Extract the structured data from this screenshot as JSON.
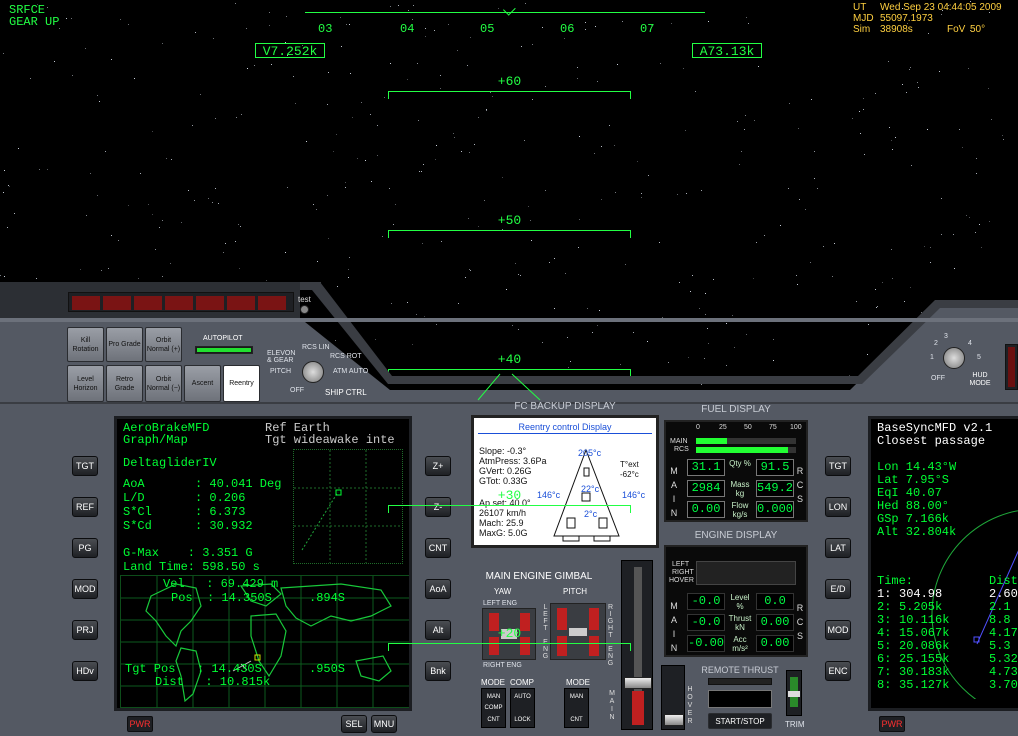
{
  "hud": {
    "mode_line1": "SRFCE",
    "mode_line2": "GEAR UP",
    "heading_ticks": [
      "03",
      "04",
      "05",
      "06",
      "07"
    ],
    "velocity": "V7.252k",
    "altitude": "A73.13k",
    "pitch_ladder": [
      "+60",
      "+50",
      "+40",
      "+30",
      "+20"
    ]
  },
  "sim_info": {
    "ut_label": "UT",
    "ut_value": "Wed Sep 23 04:44:05 2009",
    "mjd_label": "MJD",
    "mjd_value": "55097.1973",
    "sim_label": "Sim",
    "sim_value": "38908s",
    "fov_label": "FoV",
    "fov_value": "50°"
  },
  "warning_panel": {
    "lights": [
      "",
      "",
      "",
      "",
      "",
      "",
      ""
    ],
    "test_label": "test"
  },
  "nav_buttons": {
    "kill_rotation": "Kill Rotation",
    "pro_grade": "Pro Grade",
    "orbit_normal_plus": "Orbit Normal (+)",
    "level_horizon": "Level Horizon",
    "retro_grade": "Retro Grade",
    "orbit_normal_minus": "Orbit Normal (−)",
    "ascent": "Ascent",
    "reentry": "Reentry",
    "autopilot_label": "AUTOPILOT"
  },
  "ship_ctrl": {
    "title": "SHIP CTRL",
    "elevon": "ELEVON & GEAR",
    "rcs_lin": "RCS LIN",
    "rcs_rot": "RCS ROT",
    "pitch": "PITCH",
    "atm_auto": "ATM AUTO",
    "off": "OFF"
  },
  "hud_mode": {
    "title": "HUD MODE",
    "off": "OFF",
    "n1": "1",
    "n2": "2",
    "n3": "3",
    "n4": "4",
    "n5": "5"
  },
  "left_mfd": {
    "left_buttons": [
      "TGT",
      "REF",
      "PG",
      "MOD",
      "PRJ",
      "HDv"
    ],
    "right_buttons": [
      "Z+",
      "Z-",
      "CNT",
      "AoA",
      "Alt",
      "Bnk"
    ],
    "pwr": "PWR",
    "sel": "SEL",
    "mnu": "MNU",
    "title1": "AeroBrakeMFD",
    "title2": "Graph/Map",
    "ref": "Ref Earth",
    "tgt": "Tgt wideawake inte",
    "vessel": "DeltagliderIV",
    "rows": [
      {
        "k": "AoA",
        "v": ": 40.041 Deg"
      },
      {
        "k": "L/D",
        "v": ": 0.206"
      },
      {
        "k": "S*Cl",
        "v": ": 6.373"
      },
      {
        "k": "S*Cd",
        "v": ": 30.932"
      }
    ],
    "gmax": "G-Max    : 3.351 G",
    "land_time": "Land Time: 598.50 s",
    "vel": "Vel   : 69.429 m",
    "pos": "Pos  : 14.350S",
    "pos2": ".894S",
    "tgt_pos": "Tgt Pos   : 14.430S",
    "tgt_pos2": ".950S",
    "dist": "Dist   : 10.815k"
  },
  "fc_backup": {
    "title": "FC BACKUP DISPLAY",
    "header": "Reentry control Display",
    "slope": "Slope: -0.3°",
    "atm": "AtmPress: 3.6Pa",
    "gvert": "GVert: 0.26G",
    "gtot": "GTot: 0.33G",
    "ap": "Ap set: 40.0°",
    "speed": "26107 km/h",
    "mach": "Mach: 25.9",
    "maxg": "MaxG: 5.0G",
    "t_nose": "205°c",
    "t_ext_label": "T°ext",
    "t_ext": "-62°c",
    "t_left": "146°c",
    "t_mid": "22°c",
    "t_right": "146°c",
    "t_low": "2°c"
  },
  "fuel": {
    "title": "FUEL DISPLAY",
    "scale": [
      "0",
      "25",
      "50",
      "75",
      "100"
    ],
    "main": "MAIN",
    "rcs": "RCS",
    "qty_label": "Qty %",
    "mass_label": "Mass kg",
    "flow_label": "Flow kg/s",
    "main_qty": "31.1",
    "rcs_qty": "91.5",
    "main_mass": "2984",
    "rcs_mass": "549.2",
    "main_flow": "0.00",
    "rcs_flow": "0.000",
    "main_fill": 0.31,
    "rcs_fill": 0.915
  },
  "engine": {
    "title": "ENGINE DISPLAY",
    "left": "LEFT",
    "right": "RIGHT",
    "hover": "HOVER",
    "level_label": "Level %",
    "thrust_label": "Thrust kN",
    "acc_label": "Acc m/s²",
    "level_l": "-0.0",
    "level_r": "0.0",
    "thrust_l": "-0.0",
    "thrust_r": "0.00",
    "acc_l": "-0.00",
    "acc_r": "0.00"
  },
  "gimbal": {
    "title": "MAIN ENGINE GIMBAL",
    "yaw": "YAW",
    "pitch": "PITCH",
    "left_eng": "LEFT ENG",
    "right_eng": "RIGHT ENG",
    "left_eng_v": "LEFT ENG",
    "right_eng_v": "RIGHT ENG",
    "mode": "MODE",
    "comp": "COMP",
    "man": "MAN",
    "auto": "AUTO",
    "cnt": "CNT",
    "lock": "LOCK"
  },
  "remote_thrust": {
    "title": "REMOTE THRUST",
    "start_stop": "START/STOP",
    "trim": "TRIM",
    "main": "MAIN",
    "hover": "HOVER"
  },
  "right_mfd": {
    "left_buttons": [
      "TGT",
      "LON",
      "LAT",
      "E/D",
      "MOD",
      "ENC"
    ],
    "pwr": "PWR",
    "title": "BaseSyncMFD v2.1",
    "subtitle": "Closest passage",
    "rows": [
      "Lon 14.43°W",
      "Lat 7.95°S",
      "EqI 40.07",
      "Hed 88.00°",
      "GSp 7.166k",
      "Alt 32.804k"
    ],
    "time_label": "Time:",
    "dist_label": "Dist",
    "times": [
      {
        "n": "1:",
        "t": "304.98",
        "d": "2.60"
      },
      {
        "n": "2:",
        "t": "5.205k",
        "d": "2.1"
      },
      {
        "n": "3:",
        "t": "10.116k",
        "d": "8.8"
      },
      {
        "n": "4:",
        "t": "15.067k",
        "d": "4.17"
      },
      {
        "n": "5:",
        "t": "20.086k",
        "d": "5.3"
      },
      {
        "n": "6:",
        "t": "25.155k",
        "d": "5.32"
      },
      {
        "n": "7:",
        "t": "30.183k",
        "d": "4.73"
      },
      {
        "n": "8:",
        "t": "35.127k",
        "d": "3.70"
      }
    ]
  }
}
